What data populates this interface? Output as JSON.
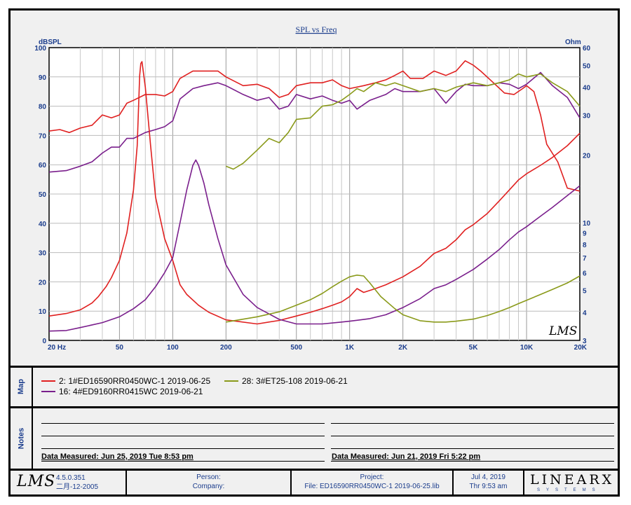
{
  "chart_data": {
    "type": "line",
    "title": "SPL vs Freq",
    "ylabel_left": "dBSPL",
    "ylabel_right": "Ohm",
    "x_scale": "log",
    "xlim": [
      20,
      20000
    ],
    "ylim_left": [
      0,
      100
    ],
    "ylim_right": [
      3,
      60
    ],
    "x_tick_labels": [
      {
        "v": 20,
        "t": "20  Hz"
      },
      {
        "v": 50,
        "t": "50"
      },
      {
        "v": 100,
        "t": "100"
      },
      {
        "v": 200,
        "t": "200"
      },
      {
        "v": 500,
        "t": "500"
      },
      {
        "v": 1000,
        "t": "1K"
      },
      {
        "v": 2000,
        "t": "2K"
      },
      {
        "v": 5000,
        "t": "5K"
      },
      {
        "v": 10000,
        "t": "10K"
      },
      {
        "v": 20000,
        "t": "20K"
      }
    ],
    "y_tick_labels_left": [
      "0",
      "10",
      "20",
      "30",
      "40",
      "50",
      "60",
      "70",
      "80",
      "90",
      "100"
    ],
    "y_tick_labels_right": [
      {
        "v": 3,
        "t": "3"
      },
      {
        "v": 4,
        "t": "4"
      },
      {
        "v": 5,
        "t": "5"
      },
      {
        "v": 6,
        "t": "6"
      },
      {
        "v": 7,
        "t": "7"
      },
      {
        "v": 8,
        "t": "8"
      },
      {
        "v": 9,
        "t": "9"
      },
      {
        "v": 10,
        "t": "10"
      },
      {
        "v": 20,
        "t": "20"
      },
      {
        "v": 30,
        "t": "30"
      },
      {
        "v": 40,
        "t": "40"
      },
      {
        "v": 50,
        "t": "50"
      },
      {
        "v": 60,
        "t": "60"
      }
    ],
    "grid": true,
    "watermark": "LMS",
    "series": [
      {
        "name": "2: 1#ED16590RR0450WC-1 2019-06-25",
        "kind": "spl",
        "color": "#e02020",
        "points": [
          [
            20,
            71.5
          ],
          [
            23,
            72
          ],
          [
            26,
            71
          ],
          [
            30,
            72.5
          ],
          [
            35,
            73.5
          ],
          [
            40,
            77
          ],
          [
            45,
            76
          ],
          [
            50,
            77
          ],
          [
            55,
            81
          ],
          [
            60,
            82
          ],
          [
            70,
            84
          ],
          [
            80,
            84
          ],
          [
            90,
            83.5
          ],
          [
            100,
            85
          ],
          [
            110,
            89.5
          ],
          [
            130,
            92
          ],
          [
            150,
            92
          ],
          [
            180,
            92
          ],
          [
            200,
            90
          ],
          [
            250,
            87
          ],
          [
            300,
            87.5
          ],
          [
            350,
            86
          ],
          [
            400,
            83
          ],
          [
            450,
            84
          ],
          [
            500,
            87
          ],
          [
            600,
            88
          ],
          [
            700,
            88
          ],
          [
            800,
            89
          ],
          [
            900,
            87
          ],
          [
            1000,
            86
          ],
          [
            1200,
            87
          ],
          [
            1400,
            88
          ],
          [
            1600,
            89
          ],
          [
            1800,
            90.5
          ],
          [
            2000,
            92
          ],
          [
            2200,
            89.5
          ],
          [
            2600,
            89.5
          ],
          [
            3000,
            92
          ],
          [
            3500,
            90.5
          ],
          [
            4000,
            92
          ],
          [
            4500,
            95.5
          ],
          [
            5000,
            94
          ],
          [
            5500,
            92
          ],
          [
            6500,
            88
          ],
          [
            7500,
            84.5
          ],
          [
            8500,
            84
          ],
          [
            9500,
            86
          ],
          [
            10000,
            87
          ],
          [
            11000,
            85
          ],
          [
            12000,
            77
          ],
          [
            13000,
            67
          ],
          [
            15000,
            61
          ],
          [
            17000,
            52
          ],
          [
            20000,
            51
          ]
        ]
      },
      {
        "name": "16: 4#ED9160RR0415WC 2019-06-21",
        "kind": "spl",
        "color": "#7a1f8c",
        "points": [
          [
            20,
            57.5
          ],
          [
            25,
            58
          ],
          [
            30,
            59.5
          ],
          [
            35,
            61
          ],
          [
            40,
            64
          ],
          [
            45,
            66
          ],
          [
            50,
            66
          ],
          [
            55,
            69
          ],
          [
            60,
            69
          ],
          [
            70,
            71
          ],
          [
            80,
            72
          ],
          [
            90,
            73
          ],
          [
            100,
            75
          ],
          [
            110,
            82.5
          ],
          [
            130,
            86
          ],
          [
            150,
            87
          ],
          [
            180,
            88
          ],
          [
            200,
            87
          ],
          [
            250,
            84
          ],
          [
            300,
            82
          ],
          [
            350,
            83
          ],
          [
            400,
            79
          ],
          [
            450,
            80
          ],
          [
            500,
            84
          ],
          [
            600,
            82.5
          ],
          [
            700,
            83.5
          ],
          [
            800,
            82
          ],
          [
            900,
            81
          ],
          [
            1000,
            82
          ],
          [
            1100,
            79
          ],
          [
            1300,
            82
          ],
          [
            1600,
            84
          ],
          [
            1800,
            86
          ],
          [
            2000,
            85
          ],
          [
            2500,
            85
          ],
          [
            3000,
            86
          ],
          [
            3500,
            81
          ],
          [
            4000,
            85
          ],
          [
            4500,
            87.5
          ],
          [
            5000,
            87
          ],
          [
            6000,
            87
          ],
          [
            7000,
            88
          ],
          [
            8000,
            87.5
          ],
          [
            9000,
            86
          ],
          [
            10000,
            87.5
          ],
          [
            12000,
            91.5
          ],
          [
            14000,
            87
          ],
          [
            17000,
            83
          ],
          [
            20000,
            76
          ]
        ]
      },
      {
        "name": "28: 3#ET25-108  2019-06-21",
        "kind": "spl",
        "color": "#8a9a1a",
        "points": [
          [
            200,
            59.5
          ],
          [
            220,
            58.5
          ],
          [
            250,
            60.5
          ],
          [
            300,
            65
          ],
          [
            350,
            69
          ],
          [
            400,
            67.5
          ],
          [
            450,
            71
          ],
          [
            500,
            75.5
          ],
          [
            600,
            76
          ],
          [
            700,
            80
          ],
          [
            800,
            80.5
          ],
          [
            900,
            82
          ],
          [
            1000,
            84
          ],
          [
            1100,
            86
          ],
          [
            1200,
            85
          ],
          [
            1400,
            88
          ],
          [
            1600,
            87
          ],
          [
            1800,
            88
          ],
          [
            2000,
            87
          ],
          [
            2500,
            85
          ],
          [
            3000,
            86
          ],
          [
            3500,
            85
          ],
          [
            4000,
            86.5
          ],
          [
            5000,
            88
          ],
          [
            6000,
            87
          ],
          [
            7000,
            88
          ],
          [
            8000,
            89
          ],
          [
            9000,
            91
          ],
          [
            10000,
            90
          ],
          [
            12000,
            91
          ],
          [
            14000,
            88
          ],
          [
            17000,
            85
          ],
          [
            20000,
            80
          ]
        ]
      },
      {
        "name": "2: 1#ED16590RR0450WC-1 2019-06-25",
        "kind": "impedance",
        "color": "#e02020",
        "points": [
          [
            20,
            3.85
          ],
          [
            25,
            3.95
          ],
          [
            30,
            4.1
          ],
          [
            35,
            4.4
          ],
          [
            38,
            4.7
          ],
          [
            42,
            5.2
          ],
          [
            45,
            5.7
          ],
          [
            50,
            6.8
          ],
          [
            55,
            9
          ],
          [
            60,
            14
          ],
          [
            63,
            22
          ],
          [
            65,
            45
          ],
          [
            66,
            51
          ],
          [
            67,
            52
          ],
          [
            70,
            40
          ],
          [
            75,
            22
          ],
          [
            80,
            13
          ],
          [
            90,
            8.5
          ],
          [
            100,
            6.8
          ],
          [
            110,
            5.3
          ],
          [
            120,
            4.8
          ],
          [
            140,
            4.3
          ],
          [
            160,
            4
          ],
          [
            200,
            3.7
          ],
          [
            300,
            3.55
          ],
          [
            400,
            3.68
          ],
          [
            500,
            3.85
          ],
          [
            600,
            4
          ],
          [
            700,
            4.15
          ],
          [
            800,
            4.3
          ],
          [
            900,
            4.45
          ],
          [
            1000,
            4.7
          ],
          [
            1100,
            5.1
          ],
          [
            1200,
            4.9
          ],
          [
            1400,
            5.1
          ],
          [
            1600,
            5.3
          ],
          [
            2000,
            5.75
          ],
          [
            2500,
            6.4
          ],
          [
            3000,
            7.3
          ],
          [
            3500,
            7.7
          ],
          [
            4000,
            8.4
          ],
          [
            4500,
            9.3
          ],
          [
            5000,
            9.8
          ],
          [
            6000,
            11
          ],
          [
            7000,
            12.5
          ],
          [
            8000,
            14
          ],
          [
            9000,
            15.5
          ],
          [
            10000,
            16.5
          ],
          [
            12000,
            18
          ],
          [
            14000,
            19.5
          ],
          [
            17000,
            22
          ],
          [
            20000,
            25
          ]
        ]
      },
      {
        "name": "16: 4#ED9160RR0415WC 2019-06-21",
        "kind": "impedance",
        "color": "#7a1f8c",
        "points": [
          [
            20,
            3.3
          ],
          [
            25,
            3.32
          ],
          [
            30,
            3.42
          ],
          [
            40,
            3.6
          ],
          [
            50,
            3.82
          ],
          [
            60,
            4.15
          ],
          [
            70,
            4.55
          ],
          [
            80,
            5.2
          ],
          [
            90,
            6
          ],
          [
            100,
            7
          ],
          [
            110,
            10
          ],
          [
            120,
            14
          ],
          [
            130,
            18
          ],
          [
            135,
            19
          ],
          [
            140,
            18
          ],
          [
            150,
            15
          ],
          [
            160,
            12
          ],
          [
            180,
            8.5
          ],
          [
            200,
            6.5
          ],
          [
            250,
            4.8
          ],
          [
            300,
            4.2
          ],
          [
            400,
            3.72
          ],
          [
            500,
            3.55
          ],
          [
            700,
            3.55
          ],
          [
            900,
            3.62
          ],
          [
            1000,
            3.65
          ],
          [
            1300,
            3.75
          ],
          [
            1600,
            3.9
          ],
          [
            2000,
            4.2
          ],
          [
            2500,
            4.6
          ],
          [
            3000,
            5.1
          ],
          [
            3500,
            5.3
          ],
          [
            4000,
            5.6
          ],
          [
            5000,
            6.2
          ],
          [
            6000,
            6.9
          ],
          [
            7000,
            7.6
          ],
          [
            8000,
            8.4
          ],
          [
            9000,
            9.1
          ],
          [
            10000,
            9.6
          ],
          [
            12000,
            10.7
          ],
          [
            14000,
            11.7
          ],
          [
            17000,
            13.2
          ],
          [
            20000,
            14.6
          ]
        ]
      },
      {
        "name": "28: 3#ET25-108  2019-06-21",
        "kind": "impedance",
        "color": "#8a9a1a",
        "points": [
          [
            200,
            3.62
          ],
          [
            300,
            3.82
          ],
          [
            400,
            4.02
          ],
          [
            500,
            4.3
          ],
          [
            600,
            4.55
          ],
          [
            700,
            4.85
          ],
          [
            800,
            5.2
          ],
          [
            900,
            5.5
          ],
          [
            1000,
            5.75
          ],
          [
            1100,
            5.85
          ],
          [
            1200,
            5.8
          ],
          [
            1300,
            5.4
          ],
          [
            1500,
            4.7
          ],
          [
            1800,
            4.15
          ],
          [
            2000,
            3.9
          ],
          [
            2500,
            3.67
          ],
          [
            3000,
            3.62
          ],
          [
            3500,
            3.62
          ],
          [
            4000,
            3.65
          ],
          [
            5000,
            3.73
          ],
          [
            6000,
            3.87
          ],
          [
            7000,
            4.03
          ],
          [
            8000,
            4.2
          ],
          [
            9000,
            4.37
          ],
          [
            10000,
            4.52
          ],
          [
            12000,
            4.8
          ],
          [
            14000,
            5.05
          ],
          [
            17000,
            5.4
          ],
          [
            20000,
            5.8
          ]
        ]
      }
    ]
  },
  "map": {
    "label": "Map",
    "legend": [
      {
        "text": "2: 1#ED16590RR0450WC-1 2019-06-25",
        "color": "#e02020"
      },
      {
        "text": "28: 3#ET25-108  2019-06-21",
        "color": "#8a9a1a"
      },
      {
        "text": "16: 4#ED9160RR0415WC 2019-06-21",
        "color": "#7a1f8c"
      }
    ]
  },
  "notes": {
    "label": "Notes",
    "measured_left": "Data Measured:  Jun 25, 2019  Tue  8:53 pm",
    "measured_right": "Data Measured:  Jun 21, 2019  Fri  5:22 pm"
  },
  "footer": {
    "logo": "LMS",
    "version": "4.5.0.351",
    "version_date": "二月-12-2005",
    "person_label": "Person:",
    "company_label": "Company:",
    "project_label": "Project:",
    "file_label": "File: ED16590RR0450WC-1 2019-06-25.lib",
    "date": "Jul  4, 2019",
    "time": "Thr  9:53 am",
    "brand": "LINEARX",
    "brand_sub": "SYSTEMS"
  }
}
